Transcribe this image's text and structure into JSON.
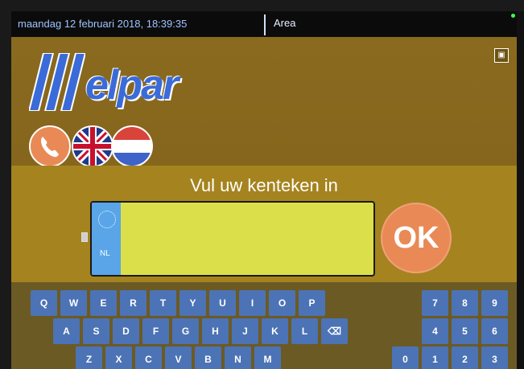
{
  "topbar": {
    "datetime": "maandag 12 februari 2018, 18:39:35",
    "area": "Area"
  },
  "header": {
    "logo_text": "elpar",
    "top_right_icon": "save-icon"
  },
  "languages": {
    "phone_icon": "phone-icon",
    "uk_flag": "uk-flag-icon",
    "nl_flag": "nl-flag-icon"
  },
  "panel": {
    "prompt": "Vul uw kenteken in",
    "plate_country": "NL",
    "plate_value": "",
    "ok_label": "OK"
  },
  "keyboard": {
    "row1": [
      "Q",
      "W",
      "E",
      "R",
      "T",
      "Y",
      "U",
      "I",
      "O",
      "P"
    ],
    "row2": [
      "A",
      "S",
      "D",
      "F",
      "G",
      "H",
      "J",
      "K",
      "L"
    ],
    "row3": [
      "Z",
      "X",
      "C",
      "V",
      "B",
      "N",
      "M"
    ],
    "backspace_icon": "backspace-icon",
    "numpad": [
      "7",
      "8",
      "9",
      "4",
      "5",
      "6",
      "0",
      "1",
      "2",
      "3"
    ]
  },
  "colors": {
    "background": "#8c6a20",
    "panel": "#a5831f",
    "plate": "#dbe04a",
    "plate_strip": "#59a5e8",
    "ok_button": "#e98a56",
    "key": "#4c73b5",
    "keyboard_bg": "#6c5a25"
  }
}
